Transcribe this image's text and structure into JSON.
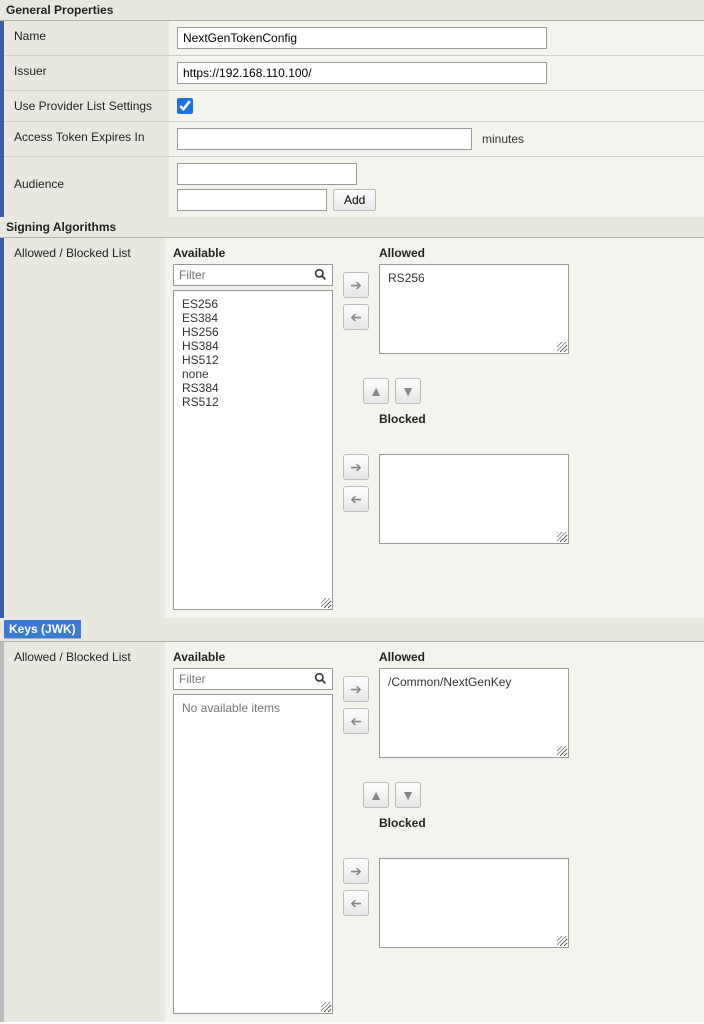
{
  "sections": {
    "general": "General Properties",
    "signing": "Signing Algorithms",
    "keys": "Keys (JWK)"
  },
  "general": {
    "name_label": "Name",
    "name_value": "NextGenTokenConfig",
    "issuer_label": "Issuer",
    "issuer_value": "https://192.168.110.100/",
    "useprov_label": "Use Provider List Settings",
    "useprov_checked": true,
    "expires_label": "Access Token Expires In",
    "expires_value": "",
    "expires_suffix": "minutes",
    "audience_label": "Audience",
    "audience_value1": "",
    "audience_value2": "",
    "add_label": "Add"
  },
  "picker": {
    "list_label": "Allowed / Blocked List",
    "available_label": "Available",
    "allowed_label": "Allowed",
    "blocked_label": "Blocked",
    "filter_placeholder": "Filter",
    "no_items": "No available items"
  },
  "signing": {
    "available": [
      "ES256",
      "ES384",
      "HS256",
      "HS384",
      "HS512",
      "none",
      "RS384",
      "RS512"
    ],
    "allowed": [
      "RS256"
    ],
    "blocked": []
  },
  "keys": {
    "available": [],
    "allowed": [
      "/Common/NextGenKey"
    ],
    "blocked": []
  }
}
